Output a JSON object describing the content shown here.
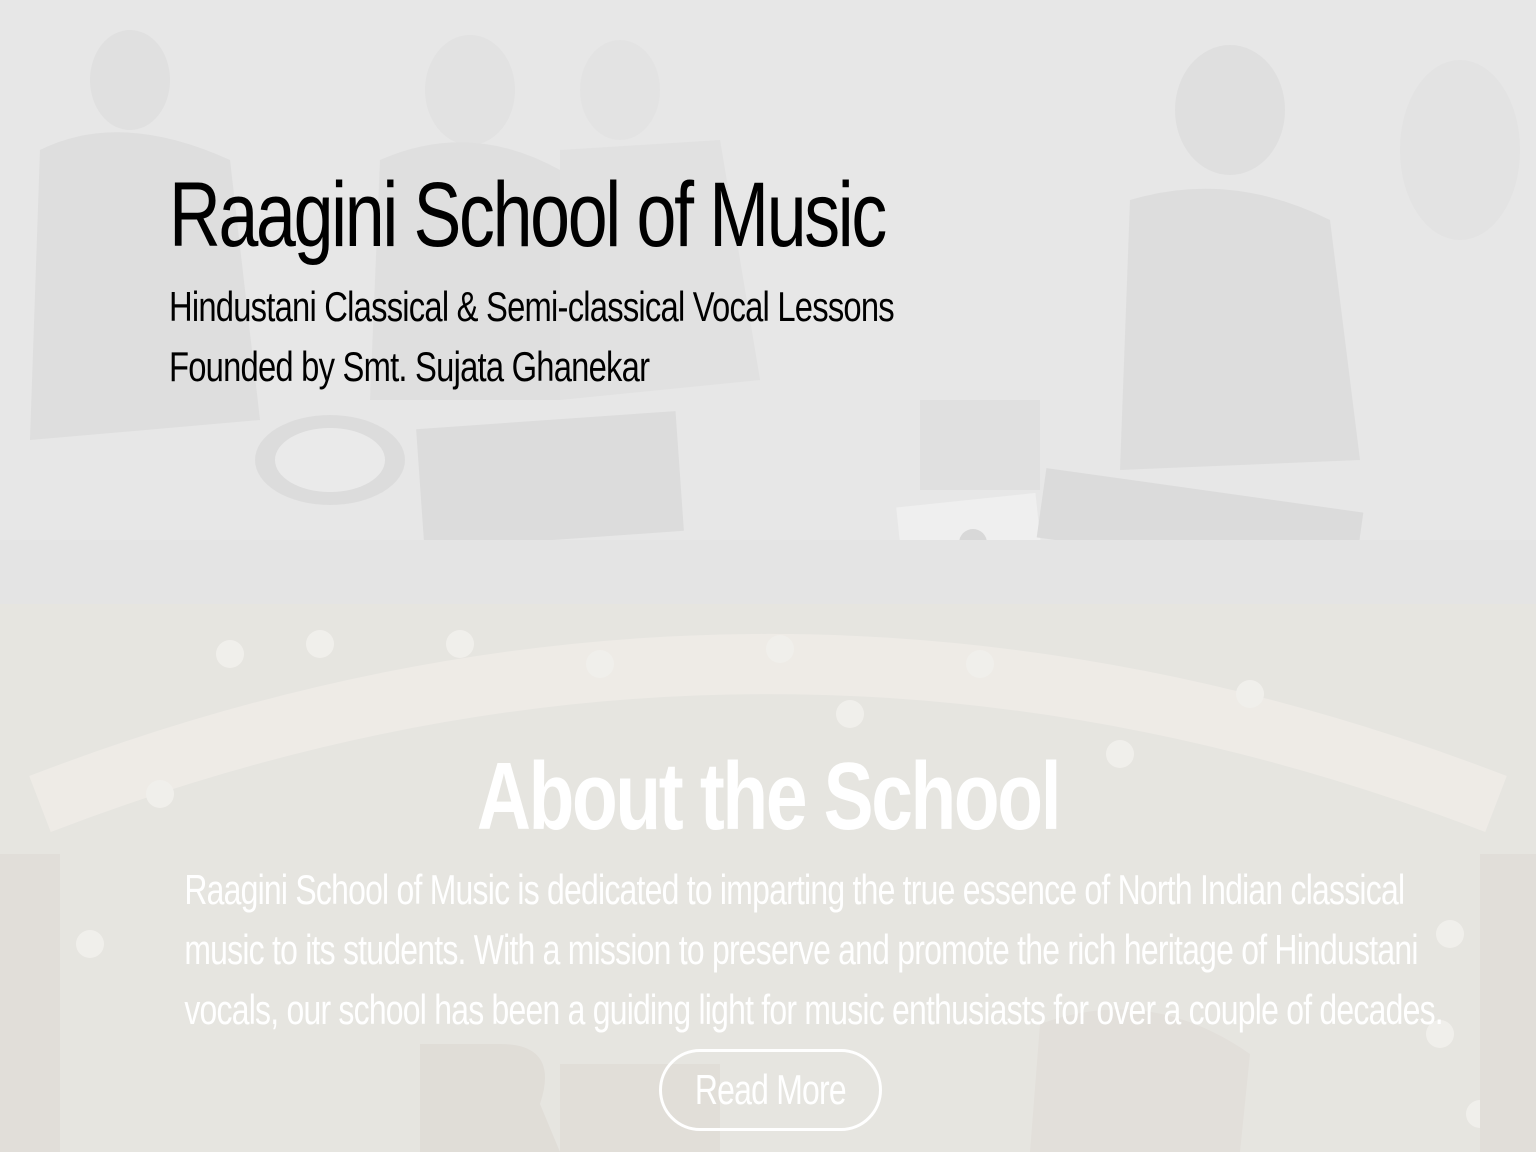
{
  "hero": {
    "title": "Raagini School of Music",
    "subtitle_line1": "Hindustani Classical & Semi-classical Vocal Lessons",
    "subtitle_line2": "Founded by Smt. Sujata Ghanekar"
  },
  "about": {
    "heading": "About the School",
    "body_lines": [
      "Raagini School of Music is dedicated to imparting the true essence of North Indian classical",
      "music to its students. With a mission to preserve and promote the rich heritage of Hindustani",
      "vocals, our school has been a guiding light for music enthusiasts for over a couple of decades."
    ],
    "read_more_label": "Read More"
  },
  "colors": {
    "text": "#ffffff",
    "overlay": "#f5f5f5"
  }
}
